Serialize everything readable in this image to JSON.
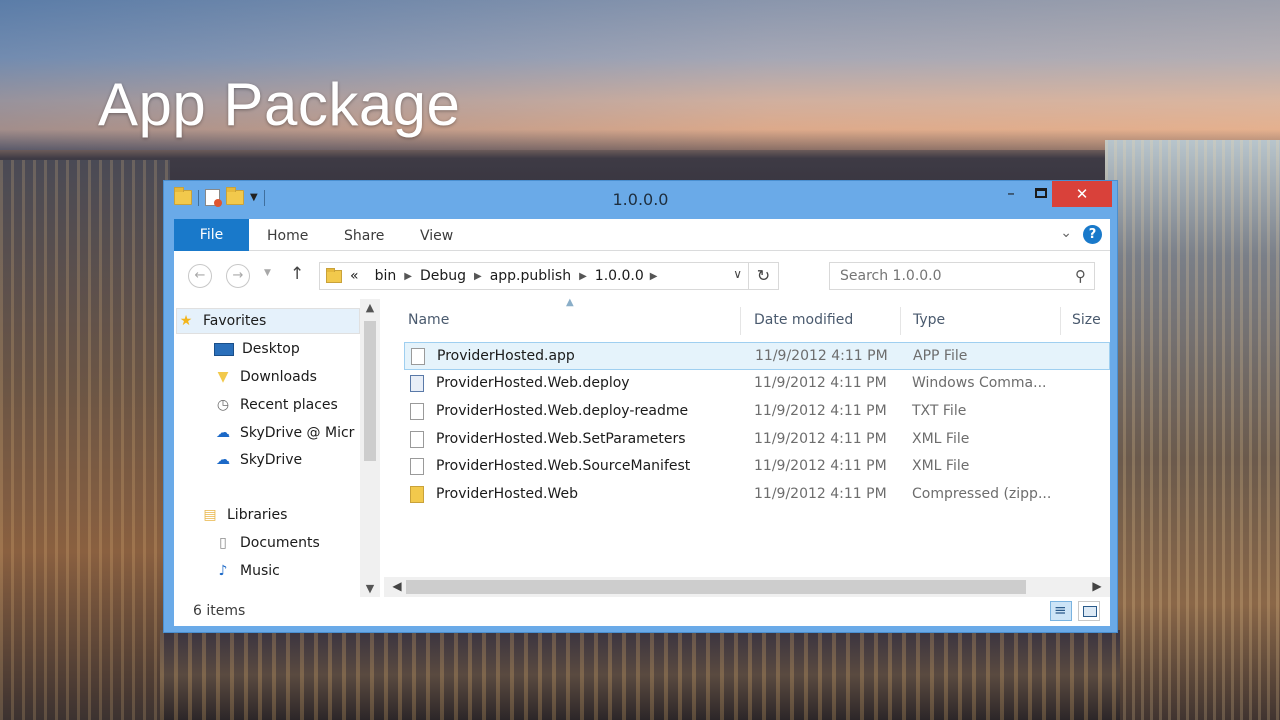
{
  "slide": {
    "title": "App Package"
  },
  "window": {
    "title": "1.0.0.0",
    "controls": {
      "minimize": "–",
      "maximize": "",
      "close": "✕"
    }
  },
  "ribbon": {
    "tabs": [
      "File",
      "Home",
      "Share",
      "View"
    ],
    "expand_glyph": "⌄",
    "help_glyph": "?"
  },
  "address_bar": {
    "overflow": "«",
    "crumbs": [
      "bin",
      "Debug",
      "app.publish",
      "1.0.0.0"
    ]
  },
  "search": {
    "placeholder": "Search 1.0.0.0"
  },
  "nav_pane": {
    "items": [
      {
        "label": "Favorites",
        "icon": "star-icon"
      },
      {
        "label": "Desktop",
        "icon": "desktop-icon"
      },
      {
        "label": "Downloads",
        "icon": "downloads-icon"
      },
      {
        "label": "Recent places",
        "icon": "recent-places-icon"
      },
      {
        "label": "SkyDrive @ Micr",
        "icon": "skydrive-icon"
      },
      {
        "label": "SkyDrive",
        "icon": "skydrive-icon"
      },
      {
        "label": "Libraries",
        "icon": "libraries-icon"
      },
      {
        "label": "Documents",
        "icon": "documents-icon"
      },
      {
        "label": "Music",
        "icon": "music-icon"
      }
    ]
  },
  "file_list": {
    "columns": [
      "Name",
      "Date modified",
      "Type",
      "Size"
    ],
    "rows": [
      {
        "name": "ProviderHosted.app",
        "date": "11/9/2012 4:11 PM",
        "type": "APP File",
        "icon": "file-icon"
      },
      {
        "name": "ProviderHosted.Web.deploy",
        "date": "11/9/2012 4:11 PM",
        "type": "Windows Comma...",
        "icon": "script-icon"
      },
      {
        "name": "ProviderHosted.Web.deploy-readme",
        "date": "11/9/2012 4:11 PM",
        "type": "TXT File",
        "icon": "file-icon"
      },
      {
        "name": "ProviderHosted.Web.SetParameters",
        "date": "11/9/2012 4:11 PM",
        "type": "XML File",
        "icon": "file-icon"
      },
      {
        "name": "ProviderHosted.Web.SourceManifest",
        "date": "11/9/2012 4:11 PM",
        "type": "XML File",
        "icon": "file-icon"
      },
      {
        "name": "ProviderHosted.Web",
        "date": "11/9/2012 4:11 PM",
        "type": "Compressed (zipp...",
        "icon": "zip-icon"
      }
    ]
  },
  "status": {
    "item_count": "6 items"
  },
  "colors": {
    "window_frame": "#6aaae8",
    "accent": "#1979ca",
    "close": "#d9413a",
    "selection": "#e5f3fb"
  }
}
